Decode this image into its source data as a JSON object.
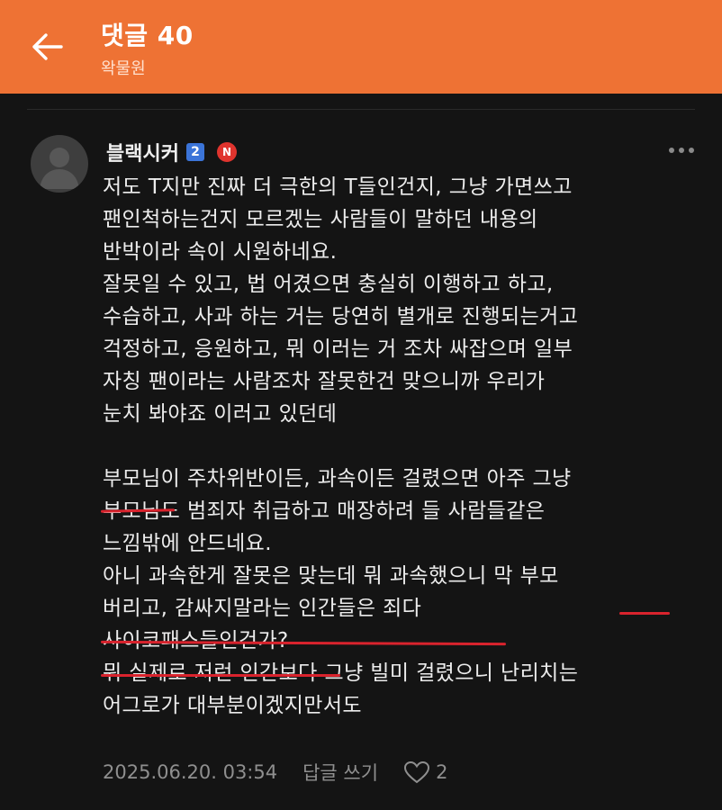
{
  "header": {
    "title": "댓글 40",
    "subtitle": "왁물원"
  },
  "comment": {
    "author": "블랙시커",
    "level_badge": "2",
    "new_badge": "N",
    "lines": [
      "저도 T지만 진짜 더 극한의 T들인건지, 그냥 가면쓰고",
      "팬인척하는건지 모르겠는 사람들이 말하던 내용의",
      "반박이라 속이 시원하네요.",
      "잘못일 수 있고, 법 어겼으면 충실히 이행하고 하고,",
      "수습하고, 사과 하는 거는 당연히 별개로 진행되는거고",
      "걱정하고, 응원하고, 뭐 이러는 거 조차 싸잡으며 일부",
      "자칭 팬이라는 사람조차 잘못한건 맞으니까 우리가",
      "눈치 봐야죠 이러고 있던데",
      "",
      "부모님이 주차위반이든, 과속이든 걸렸으면 아주 그냥",
      "부모님도 범죄자 취급하고 매장하려 들 사람들같은",
      "느낌밖에 안드네요.",
      "아니 과속한게 잘못은 맞는데 뭐 과속했으니 막 부모",
      "버리고, 감싸지말라는 인간들은 죄다",
      "사이코패스들인건가?",
      "뭐 실제로 저런 인간보다 그냥 빌미 걸렸으니 난리치는",
      "어그로가 대부분이겠지만서도"
    ],
    "timestamp": "2025.06.20. 03:54",
    "reply_label": "답글 쓰기",
    "like_count": "2"
  },
  "colors": {
    "header_bg": "#ee7234",
    "background": "#141414",
    "underline": "#d9232d",
    "level_badge": "#3b74d8",
    "new_badge": "#e0342e"
  }
}
